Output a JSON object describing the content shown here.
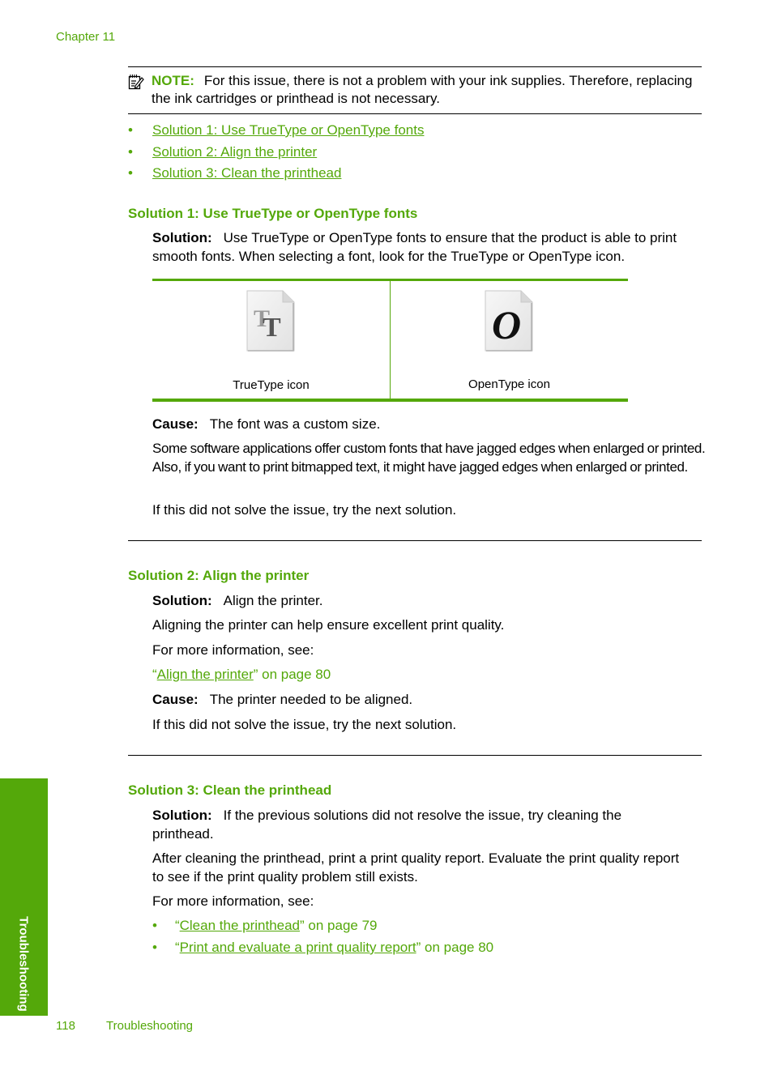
{
  "header": {
    "chapter": "Chapter 11"
  },
  "note": {
    "label": "NOTE:",
    "text": "For this issue, there is not a problem with your ink supplies. Therefore, replacing the ink cartridges or printhead is not necessary.",
    "icon": "note-pencil-icon"
  },
  "toc": [
    {
      "label": "Solution 1: Use TrueType or OpenType fonts"
    },
    {
      "label": "Solution 2: Align the printer"
    },
    {
      "label": "Solution 3: Clean the printhead"
    }
  ],
  "solution1": {
    "heading": "Solution 1: Use TrueType or OpenType fonts",
    "solution_label": "Solution:",
    "solution_text": "Use TrueType or OpenType fonts to ensure that the product is able to print smooth fonts. When selecting a font, look for the TrueType or OpenType icon.",
    "figure": {
      "truetype_caption": "TrueType icon",
      "opentype_caption": "OpenType icon",
      "truetype_glyph": "TT",
      "opentype_glyph": "O"
    },
    "cause_label": "Cause:",
    "cause_text": "The font was a custom size.",
    "para1": "Some software applications offer custom fonts that have jagged edges when enlarged or printed. Also, if you want to print bitmapped text, it might have jagged edges when enlarged or printed.",
    "next": "If this did not solve the issue, try the next solution."
  },
  "solution2": {
    "heading": "Solution 2: Align the printer",
    "solution_label": "Solution:",
    "solution_text": "Align the printer.",
    "para1": "Aligning the printer can help ensure excellent print quality.",
    "more_info": "For more information, see:",
    "link_open_quote": "“",
    "link_text": "Align the printer",
    "link_suffix": "” on page 80",
    "cause_label": "Cause:",
    "cause_text": "The printer needed to be aligned.",
    "next": "If this did not solve the issue, try the next solution."
  },
  "solution3": {
    "heading": "Solution 3: Clean the printhead",
    "solution_label": "Solution:",
    "solution_text": "If the previous solutions did not resolve the issue, try cleaning the printhead.",
    "para1": "After cleaning the printhead, print a print quality report. Evaluate the print quality report to see if the print quality problem still exists.",
    "more_info": "For more information, see:",
    "links": [
      {
        "open": "“",
        "text": "Clean the printhead",
        "suffix": "” on page 79"
      },
      {
        "open": "“",
        "text": "Print and evaluate a print quality report",
        "suffix": "” on page 80"
      }
    ]
  },
  "sidetab": {
    "label": "Troubleshooting"
  },
  "footer": {
    "page_number": "118",
    "section": "Troubleshooting"
  },
  "colors": {
    "accent": "#54a80a",
    "text": "#000000"
  }
}
